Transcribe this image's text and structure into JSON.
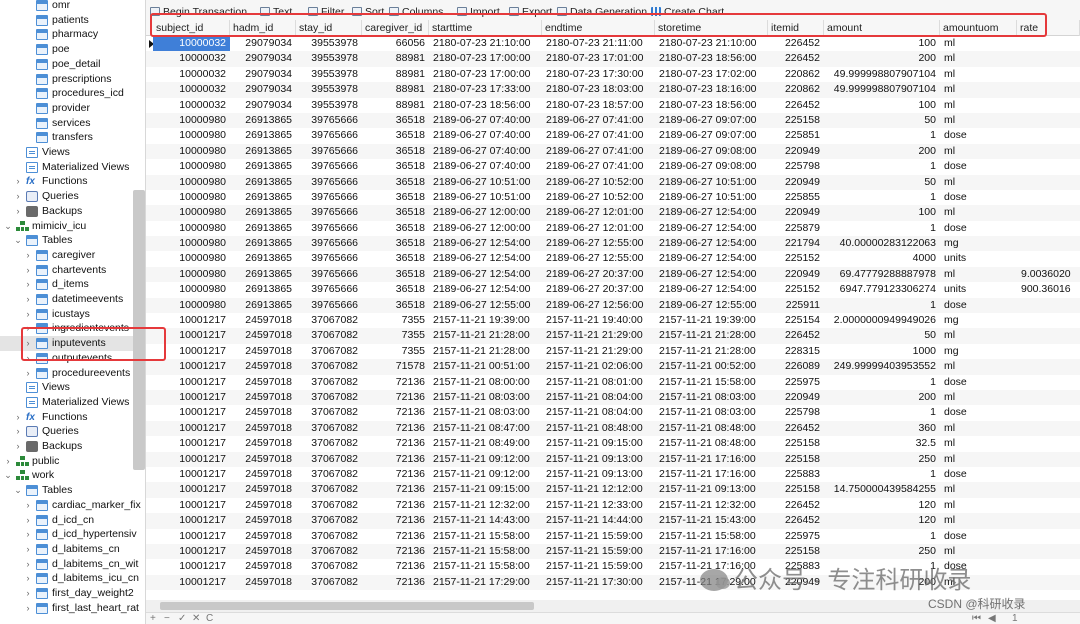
{
  "sidebar": {
    "items": [
      {
        "label": "omr",
        "icon": "table-icon",
        "depth": 3,
        "chevron": ""
      },
      {
        "label": "patients",
        "icon": "table-icon",
        "depth": 3,
        "chevron": ""
      },
      {
        "label": "pharmacy",
        "icon": "table-icon",
        "depth": 3,
        "chevron": ""
      },
      {
        "label": "poe",
        "icon": "table-icon",
        "depth": 3,
        "chevron": ""
      },
      {
        "label": "poe_detail",
        "icon": "table-icon",
        "depth": 3,
        "chevron": ""
      },
      {
        "label": "prescriptions",
        "icon": "table-icon",
        "depth": 3,
        "chevron": ""
      },
      {
        "label": "procedures_icd",
        "icon": "table-icon",
        "depth": 3,
        "chevron": ""
      },
      {
        "label": "provider",
        "icon": "table-icon",
        "depth": 3,
        "chevron": ""
      },
      {
        "label": "services",
        "icon": "table-icon",
        "depth": 3,
        "chevron": ""
      },
      {
        "label": "transfers",
        "icon": "table-icon",
        "depth": 3,
        "chevron": ""
      },
      {
        "label": "Views",
        "icon": "view-icon",
        "depth": 2,
        "chevron": ""
      },
      {
        "label": "Materialized Views",
        "icon": "view-icon",
        "depth": 2,
        "chevron": ""
      },
      {
        "label": "Functions",
        "icon": "function-icon",
        "depth": 2,
        "chevron": ">"
      },
      {
        "label": "Queries",
        "icon": "query-icon",
        "depth": 2,
        "chevron": ">"
      },
      {
        "label": "Backups",
        "icon": "backup-icon",
        "depth": 2,
        "chevron": ">"
      },
      {
        "label": "mimiciv_icu",
        "icon": "schema-icon",
        "depth": 1,
        "chevron": "v"
      },
      {
        "label": "Tables",
        "icon": "table-icon",
        "depth": 2,
        "chevron": "v"
      },
      {
        "label": "caregiver",
        "icon": "table-icon",
        "depth": 3,
        "chevron": ">"
      },
      {
        "label": "chartevents",
        "icon": "table-icon",
        "depth": 3,
        "chevron": ">"
      },
      {
        "label": "d_items",
        "icon": "table-icon",
        "depth": 3,
        "chevron": ">"
      },
      {
        "label": "datetimeevents",
        "icon": "table-icon",
        "depth": 3,
        "chevron": ">"
      },
      {
        "label": "icustays",
        "icon": "table-icon",
        "depth": 3,
        "chevron": ">"
      },
      {
        "label": "ingredientevents",
        "icon": "table-icon",
        "depth": 3,
        "chevron": ">"
      },
      {
        "label": "inputevents",
        "icon": "table-icon",
        "depth": 3,
        "chevron": ">",
        "selected": true
      },
      {
        "label": "outputevents",
        "icon": "table-icon",
        "depth": 3,
        "chevron": ">"
      },
      {
        "label": "procedureevents",
        "icon": "table-icon",
        "depth": 3,
        "chevron": ">"
      },
      {
        "label": "Views",
        "icon": "view-icon",
        "depth": 2,
        "chevron": ""
      },
      {
        "label": "Materialized Views",
        "icon": "view-icon",
        "depth": 2,
        "chevron": ""
      },
      {
        "label": "Functions",
        "icon": "function-icon",
        "depth": 2,
        "chevron": ">"
      },
      {
        "label": "Queries",
        "icon": "query-icon",
        "depth": 2,
        "chevron": ">"
      },
      {
        "label": "Backups",
        "icon": "backup-icon",
        "depth": 2,
        "chevron": ">"
      },
      {
        "label": "public",
        "icon": "schema-icon",
        "depth": 1,
        "chevron": ">"
      },
      {
        "label": "work",
        "icon": "schema-icon",
        "depth": 1,
        "chevron": "v"
      },
      {
        "label": "Tables",
        "icon": "table-icon",
        "depth": 2,
        "chevron": "v"
      },
      {
        "label": "cardiac_marker_fix",
        "icon": "table-icon",
        "depth": 3,
        "chevron": ">"
      },
      {
        "label": "d_icd_cn",
        "icon": "table-icon",
        "depth": 3,
        "chevron": ">"
      },
      {
        "label": "d_icd_hypertensiv",
        "icon": "table-icon",
        "depth": 3,
        "chevron": ">"
      },
      {
        "label": "d_labitems_cn",
        "icon": "table-icon",
        "depth": 3,
        "chevron": ">"
      },
      {
        "label": "d_labitems_cn_wit",
        "icon": "table-icon",
        "depth": 3,
        "chevron": ">"
      },
      {
        "label": "d_labitems_icu_cn",
        "icon": "table-icon",
        "depth": 3,
        "chevron": ">"
      },
      {
        "label": "first_day_weight2",
        "icon": "table-icon",
        "depth": 3,
        "chevron": ">"
      },
      {
        "label": "first_last_heart_rat",
        "icon": "table-icon",
        "depth": 3,
        "chevron": ">"
      }
    ]
  },
  "toolbar": {
    "items": [
      {
        "label": "Begin Transaction",
        "icon": "transaction-icon"
      },
      {
        "label": "Text",
        "icon": "text-icon"
      },
      {
        "label": "Filter",
        "icon": "filter-icon"
      },
      {
        "label": "Sort",
        "icon": "sort-icon"
      },
      {
        "label": "Columns",
        "icon": "columns-icon"
      },
      {
        "label": "Import",
        "icon": "import-icon"
      },
      {
        "label": "Export",
        "icon": "export-icon"
      },
      {
        "label": "Data Generation",
        "icon": "data-generation-icon"
      },
      {
        "label": "Create Chart",
        "icon": "chart-icon"
      }
    ]
  },
  "grid": {
    "columns": [
      "subject_id",
      "hadm_id",
      "stay_id",
      "caregiver_id",
      "starttime",
      "endtime",
      "storetime",
      "itemid",
      "amount",
      "amountuom",
      "rate"
    ],
    "rows": [
      [
        "10000032",
        "29079034",
        "39553978",
        "66056",
        "2180-07-23 21:10:00",
        "2180-07-23 21:11:00",
        "2180-07-23 21:10:00",
        "226452",
        "100",
        "ml",
        ""
      ],
      [
        "10000032",
        "29079034",
        "39553978",
        "88981",
        "2180-07-23 17:00:00",
        "2180-07-23 17:01:00",
        "2180-07-23 18:56:00",
        "226452",
        "200",
        "ml",
        ""
      ],
      [
        "10000032",
        "29079034",
        "39553978",
        "88981",
        "2180-07-23 17:00:00",
        "2180-07-23 17:30:00",
        "2180-07-23 17:02:00",
        "220862",
        "49.999998807907104",
        "ml",
        ""
      ],
      [
        "10000032",
        "29079034",
        "39553978",
        "88981",
        "2180-07-23 17:33:00",
        "2180-07-23 18:03:00",
        "2180-07-23 18:16:00",
        "220862",
        "49.999998807907104",
        "ml",
        ""
      ],
      [
        "10000032",
        "29079034",
        "39553978",
        "88981",
        "2180-07-23 18:56:00",
        "2180-07-23 18:57:00",
        "2180-07-23 18:56:00",
        "226452",
        "100",
        "ml",
        ""
      ],
      [
        "10000980",
        "26913865",
        "39765666",
        "36518",
        "2189-06-27 07:40:00",
        "2189-06-27 07:41:00",
        "2189-06-27 09:07:00",
        "225158",
        "50",
        "ml",
        ""
      ],
      [
        "10000980",
        "26913865",
        "39765666",
        "36518",
        "2189-06-27 07:40:00",
        "2189-06-27 07:41:00",
        "2189-06-27 09:07:00",
        "225851",
        "1",
        "dose",
        ""
      ],
      [
        "10000980",
        "26913865",
        "39765666",
        "36518",
        "2189-06-27 07:40:00",
        "2189-06-27 07:41:00",
        "2189-06-27 09:08:00",
        "220949",
        "200",
        "ml",
        ""
      ],
      [
        "10000980",
        "26913865",
        "39765666",
        "36518",
        "2189-06-27 07:40:00",
        "2189-06-27 07:41:00",
        "2189-06-27 09:08:00",
        "225798",
        "1",
        "dose",
        ""
      ],
      [
        "10000980",
        "26913865",
        "39765666",
        "36518",
        "2189-06-27 10:51:00",
        "2189-06-27 10:52:00",
        "2189-06-27 10:51:00",
        "220949",
        "50",
        "ml",
        ""
      ],
      [
        "10000980",
        "26913865",
        "39765666",
        "36518",
        "2189-06-27 10:51:00",
        "2189-06-27 10:52:00",
        "2189-06-27 10:51:00",
        "225855",
        "1",
        "dose",
        ""
      ],
      [
        "10000980",
        "26913865",
        "39765666",
        "36518",
        "2189-06-27 12:00:00",
        "2189-06-27 12:01:00",
        "2189-06-27 12:54:00",
        "220949",
        "100",
        "ml",
        ""
      ],
      [
        "10000980",
        "26913865",
        "39765666",
        "36518",
        "2189-06-27 12:00:00",
        "2189-06-27 12:01:00",
        "2189-06-27 12:54:00",
        "225879",
        "1",
        "dose",
        ""
      ],
      [
        "10000980",
        "26913865",
        "39765666",
        "36518",
        "2189-06-27 12:54:00",
        "2189-06-27 12:55:00",
        "2189-06-27 12:54:00",
        "221794",
        "40.00000283122063",
        "mg",
        ""
      ],
      [
        "10000980",
        "26913865",
        "39765666",
        "36518",
        "2189-06-27 12:54:00",
        "2189-06-27 12:55:00",
        "2189-06-27 12:54:00",
        "225152",
        "4000",
        "units",
        ""
      ],
      [
        "10000980",
        "26913865",
        "39765666",
        "36518",
        "2189-06-27 12:54:00",
        "2189-06-27 20:37:00",
        "2189-06-27 12:54:00",
        "220949",
        "69.47779288887978",
        "ml",
        "9.0036020"
      ],
      [
        "10000980",
        "26913865",
        "39765666",
        "36518",
        "2189-06-27 12:54:00",
        "2189-06-27 20:37:00",
        "2189-06-27 12:54:00",
        "225152",
        "6947.779123306274",
        "units",
        "900.36016"
      ],
      [
        "10000980",
        "26913865",
        "39765666",
        "36518",
        "2189-06-27 12:55:00",
        "2189-06-27 12:56:00",
        "2189-06-27 12:55:00",
        "225911",
        "1",
        "dose",
        ""
      ],
      [
        "10001217",
        "24597018",
        "37067082",
        "7355",
        "2157-11-21 19:39:00",
        "2157-11-21 19:40:00",
        "2157-11-21 19:39:00",
        "225154",
        "2.0000000949949026",
        "mg",
        ""
      ],
      [
        "10001217",
        "24597018",
        "37067082",
        "7355",
        "2157-11-21 21:28:00",
        "2157-11-21 21:29:00",
        "2157-11-21 21:28:00",
        "226452",
        "50",
        "ml",
        ""
      ],
      [
        "10001217",
        "24597018",
        "37067082",
        "7355",
        "2157-11-21 21:28:00",
        "2157-11-21 21:29:00",
        "2157-11-21 21:28:00",
        "228315",
        "1000",
        "mg",
        ""
      ],
      [
        "10001217",
        "24597018",
        "37067082",
        "71578",
        "2157-11-21 00:51:00",
        "2157-11-21 02:06:00",
        "2157-11-21 00:52:00",
        "226089",
        "249.99999403953552",
        "ml",
        ""
      ],
      [
        "10001217",
        "24597018",
        "37067082",
        "72136",
        "2157-11-21 08:00:00",
        "2157-11-21 08:01:00",
        "2157-11-21 15:58:00",
        "225975",
        "1",
        "dose",
        ""
      ],
      [
        "10001217",
        "24597018",
        "37067082",
        "72136",
        "2157-11-21 08:03:00",
        "2157-11-21 08:04:00",
        "2157-11-21 08:03:00",
        "220949",
        "200",
        "ml",
        ""
      ],
      [
        "10001217",
        "24597018",
        "37067082",
        "72136",
        "2157-11-21 08:03:00",
        "2157-11-21 08:04:00",
        "2157-11-21 08:03:00",
        "225798",
        "1",
        "dose",
        ""
      ],
      [
        "10001217",
        "24597018",
        "37067082",
        "72136",
        "2157-11-21 08:47:00",
        "2157-11-21 08:48:00",
        "2157-11-21 08:48:00",
        "226452",
        "360",
        "ml",
        ""
      ],
      [
        "10001217",
        "24597018",
        "37067082",
        "72136",
        "2157-11-21 08:49:00",
        "2157-11-21 09:15:00",
        "2157-11-21 08:48:00",
        "225158",
        "32.5",
        "ml",
        ""
      ],
      [
        "10001217",
        "24597018",
        "37067082",
        "72136",
        "2157-11-21 09:12:00",
        "2157-11-21 09:13:00",
        "2157-11-21 17:16:00",
        "225158",
        "250",
        "ml",
        ""
      ],
      [
        "10001217",
        "24597018",
        "37067082",
        "72136",
        "2157-11-21 09:12:00",
        "2157-11-21 09:13:00",
        "2157-11-21 17:16:00",
        "225883",
        "1",
        "dose",
        ""
      ],
      [
        "10001217",
        "24597018",
        "37067082",
        "72136",
        "2157-11-21 09:15:00",
        "2157-11-21 12:12:00",
        "2157-11-21 09:13:00",
        "225158",
        "14.750000439584255",
        "ml",
        ""
      ],
      [
        "10001217",
        "24597018",
        "37067082",
        "72136",
        "2157-11-21 12:32:00",
        "2157-11-21 12:33:00",
        "2157-11-21 12:32:00",
        "226452",
        "120",
        "ml",
        ""
      ],
      [
        "10001217",
        "24597018",
        "37067082",
        "72136",
        "2157-11-21 14:43:00",
        "2157-11-21 14:44:00",
        "2157-11-21 15:43:00",
        "226452",
        "120",
        "ml",
        ""
      ],
      [
        "10001217",
        "24597018",
        "37067082",
        "72136",
        "2157-11-21 15:58:00",
        "2157-11-21 15:59:00",
        "2157-11-21 15:58:00",
        "225975",
        "1",
        "dose",
        ""
      ],
      [
        "10001217",
        "24597018",
        "37067082",
        "72136",
        "2157-11-21 15:58:00",
        "2157-11-21 15:59:00",
        "2157-11-21 17:16:00",
        "225158",
        "250",
        "ml",
        ""
      ],
      [
        "10001217",
        "24597018",
        "37067082",
        "72136",
        "2157-11-21 15:58:00",
        "2157-11-21 15:59:00",
        "2157-11-21 17:16:00",
        "225883",
        "1",
        "dose",
        ""
      ],
      [
        "10001217",
        "24597018",
        "37067082",
        "72136",
        "2157-11-21 17:29:00",
        "2157-11-21 17:30:00",
        "2157-11-21 17:29:00",
        "220949",
        "200",
        "ml",
        ""
      ]
    ],
    "current_row": 0
  },
  "statusbar": {
    "left_buttons": [
      "+",
      "−",
      "✓",
      "✕",
      "C"
    ],
    "page_number": "1",
    "nav_first": "⏮",
    "nav_prev": "◀"
  },
  "watermark": {
    "text": "公众号 · 专注科研收录",
    "csdn": "CSDN @科研收录"
  },
  "colors": {
    "highlight_box": "#e5393b",
    "selected_cell": "#3f7fd8"
  }
}
